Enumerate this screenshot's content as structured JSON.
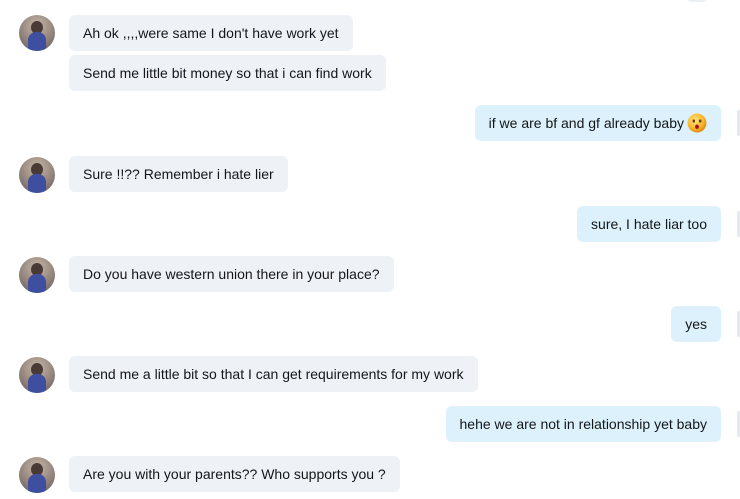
{
  "messages": [
    {
      "side": "in",
      "text": "Ah ok ,,,,were same I don't have work yet",
      "avatar": true
    },
    {
      "side": "in",
      "text": "Send me little bit money so that i can find work",
      "avatar": false
    },
    {
      "side": "out",
      "text": "if we are bf and gf already baby",
      "emoji": "kiss-emoji-icon"
    },
    {
      "side": "in",
      "text": "Sure !!?? Remember i hate lier",
      "avatar": true
    },
    {
      "side": "out",
      "text": "sure, I hate liar too"
    },
    {
      "side": "in",
      "text": "Do you have western union there in your place?",
      "avatar": true
    },
    {
      "side": "out",
      "text": "yes"
    },
    {
      "side": "in",
      "text": "Send me a little bit so that I can get requirements for my work",
      "avatar": true
    },
    {
      "side": "out",
      "text": "hehe we are not in relationship yet baby"
    },
    {
      "side": "in",
      "text": "Are you with your parents?? Who supports you ?",
      "avatar": true
    }
  ],
  "colors": {
    "incoming_bubble": "#eef1f5",
    "outgoing_bubble": "#dcf1fb",
    "text": "#14171a"
  }
}
